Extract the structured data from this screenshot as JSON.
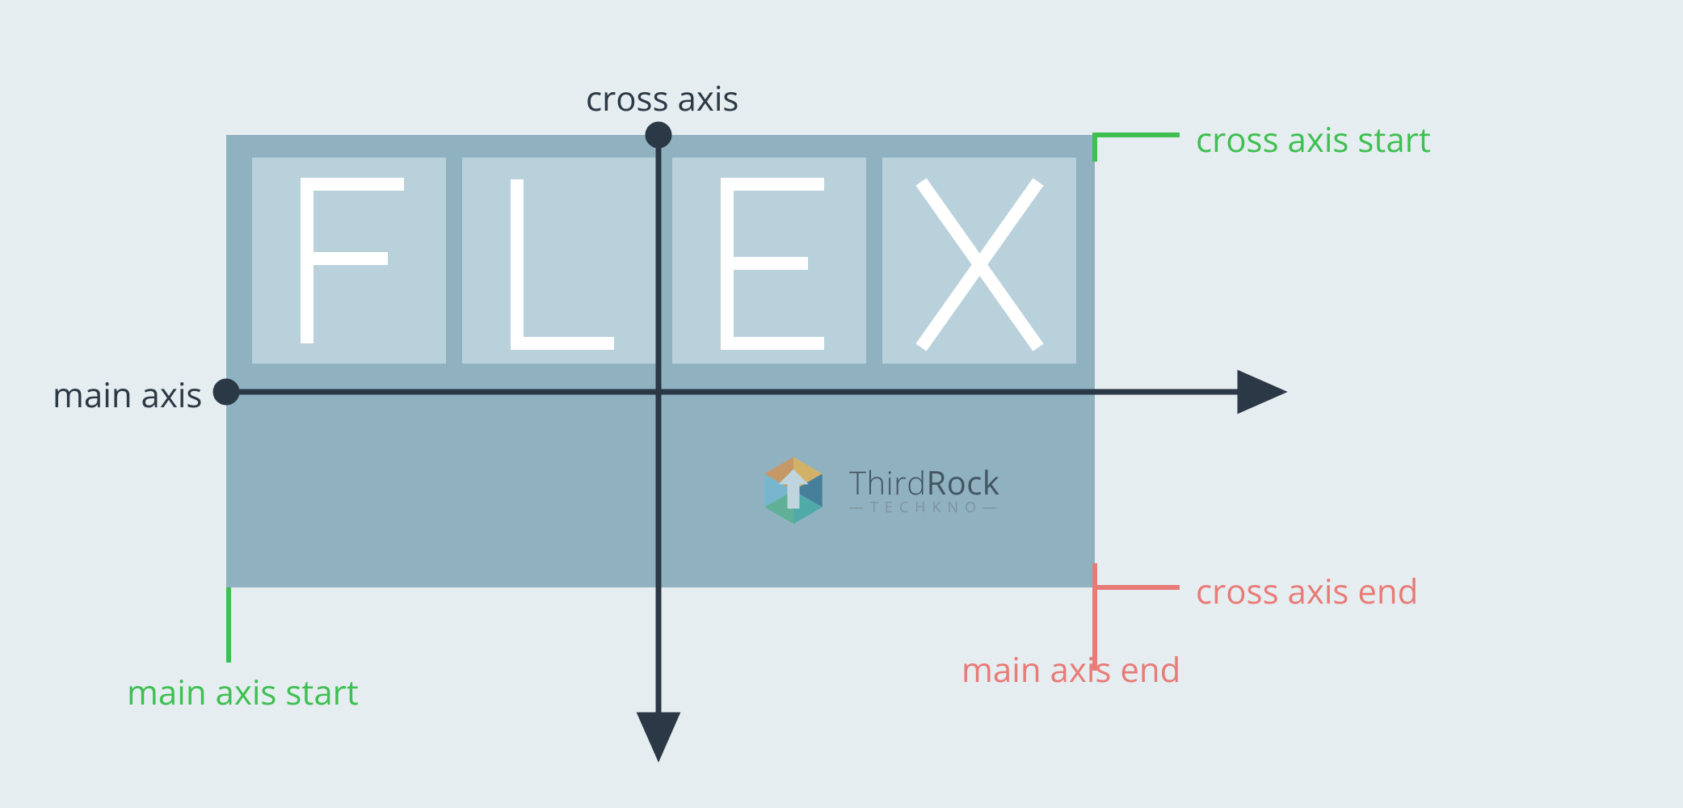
{
  "labels": {
    "cross_axis": "cross axis",
    "main_axis": "main axis",
    "cross_axis_start": "cross axis start",
    "cross_axis_end": "cross axis end",
    "main_axis_start": "main axis start",
    "main_axis_end": "main axis end"
  },
  "flex_container": {
    "items": [
      "F",
      "L",
      "E",
      "X"
    ]
  },
  "watermark": {
    "brand_a": "Third",
    "brand_b": "Rock",
    "tagline": "TECHKNO"
  },
  "colors": {
    "bg": "#e6edf0",
    "container": "#8fb1c0",
    "item_bg": "#b9d1da",
    "item_fg": "#ffffff",
    "axis": "#2b3845",
    "green": "#3fbf52",
    "red": "#e87b77"
  }
}
